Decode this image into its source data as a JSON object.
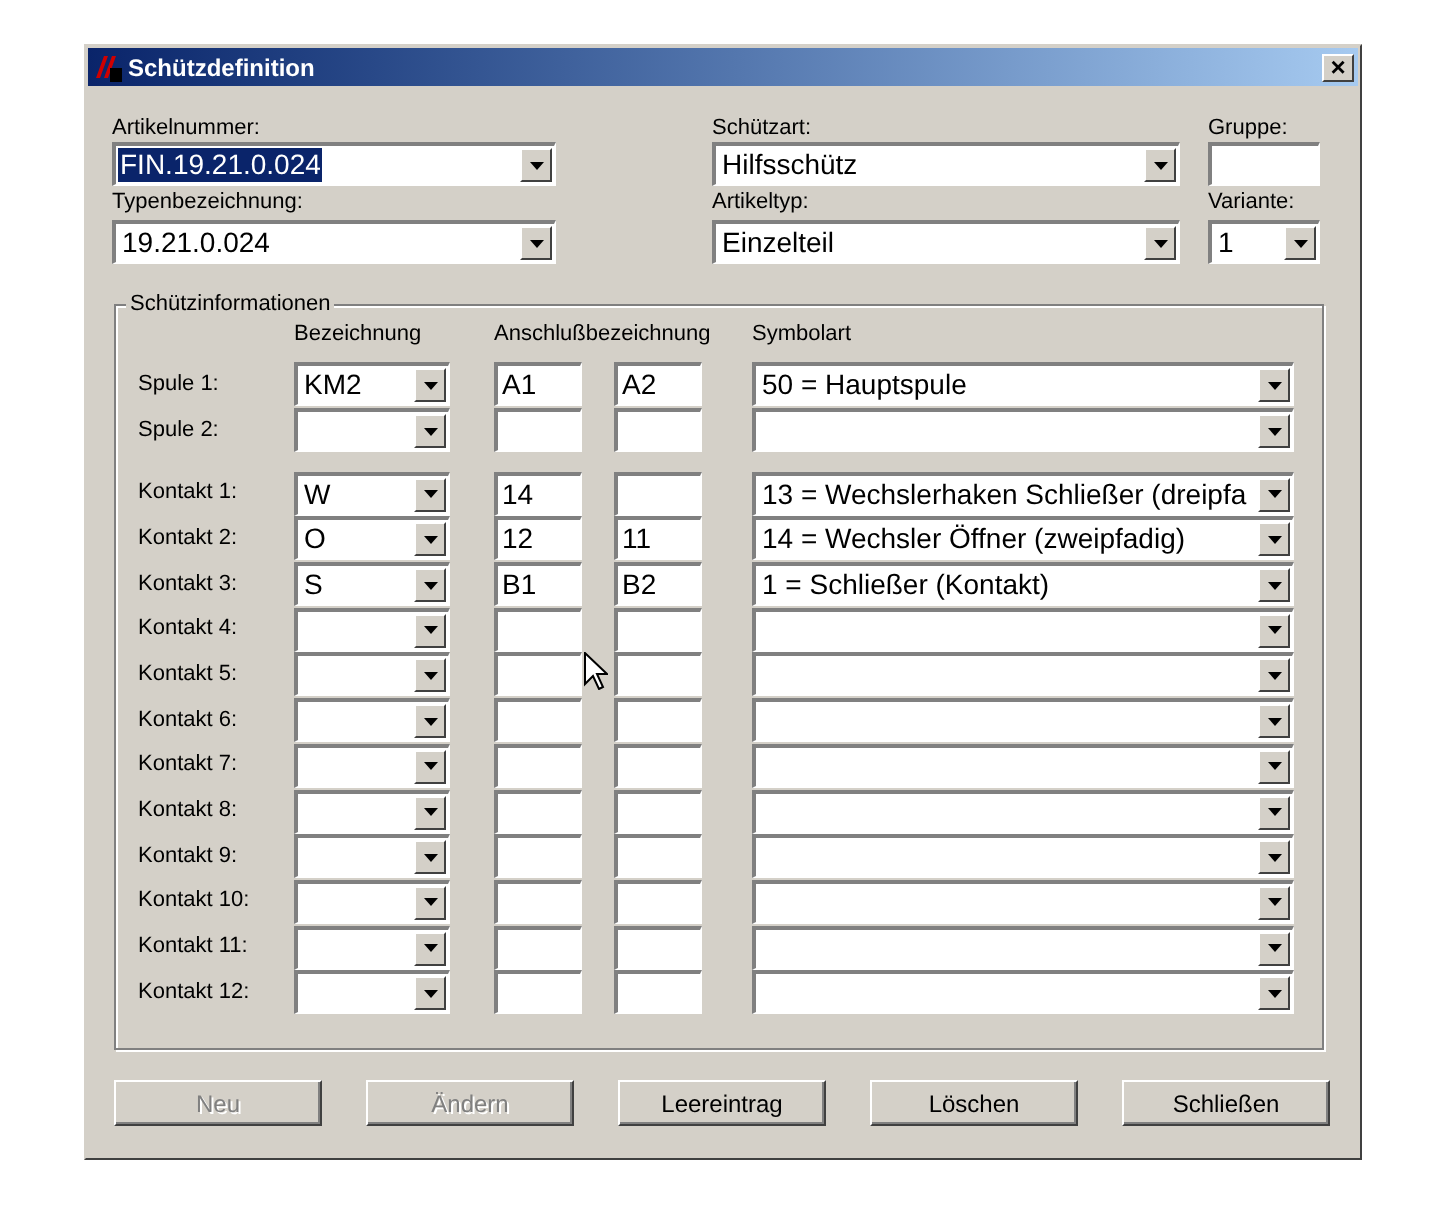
{
  "window": {
    "title": "Schützdefinition",
    "close": "×"
  },
  "header": {
    "artikelnummer": {
      "label": "Artikelnummer:",
      "value": "FIN.19.21.0.024",
      "selected": true
    },
    "typenbezeichnung": {
      "label": "Typenbezeichnung:",
      "value": "19.21.0.024"
    },
    "schuetzart": {
      "label": "Schützart:",
      "value": "Hilfsschütz"
    },
    "artikeltyp": {
      "label": "Artikeltyp:",
      "value": "Einzelteil"
    },
    "gruppe": {
      "label": "Gruppe:"
    },
    "variante": {
      "label": "Variante:",
      "value": "1"
    }
  },
  "group": {
    "title": "Schützinformationen",
    "columns": [
      "Bezeichnung",
      "Anschlußbezeichnung",
      "Symbolart"
    ],
    "rows": [
      {
        "kind": "spule",
        "label": "Spule 1:",
        "bezeichnung": "KM2",
        "anschluss_1": "A1",
        "anschluss_2": "A2",
        "symbolart": "50 = Hauptspule"
      },
      {
        "kind": "spule",
        "label": "Spule 2:"
      },
      {
        "kind": "kontakt",
        "label": "Kontakt 1:",
        "bezeichnung": "W",
        "anschluss_1": "14",
        "symbolart": "13 = Wechslerhaken Schließer (dreipfa"
      },
      {
        "kind": "kontakt",
        "label": "Kontakt 2:",
        "bezeichnung": "O",
        "anschluss_1": "12",
        "anschluss_2": "11",
        "symbolart": "14 = Wechsler Öffner (zweipfadig)"
      },
      {
        "kind": "kontakt",
        "label": "Kontakt 3:",
        "bezeichnung": "S",
        "anschluss_1": "B1",
        "anschluss_2": "B2",
        "symbolart": "1 = Schließer (Kontakt)"
      },
      {
        "kind": "kontakt",
        "label": "Kontakt 4:"
      },
      {
        "kind": "kontakt",
        "label": "Kontakt 5:"
      },
      {
        "kind": "kontakt",
        "label": "Kontakt 6:"
      },
      {
        "kind": "kontakt",
        "label": "Kontakt 7:"
      },
      {
        "kind": "kontakt",
        "label": "Kontakt 8:"
      },
      {
        "kind": "kontakt",
        "label": "Kontakt 9:"
      },
      {
        "kind": "kontakt",
        "label": "Kontakt 10:"
      },
      {
        "kind": "kontakt",
        "label": "Kontakt 11:"
      },
      {
        "kind": "kontakt",
        "label": "Kontakt 12:"
      }
    ]
  },
  "buttons": [
    {
      "label": "Neu",
      "disabled": true
    },
    {
      "label": "Ändern",
      "disabled": true
    },
    {
      "label": "Leereintrag",
      "disabled": false
    },
    {
      "label": "Löschen",
      "disabled": false
    },
    {
      "label": "Schließen",
      "disabled": false
    }
  ]
}
